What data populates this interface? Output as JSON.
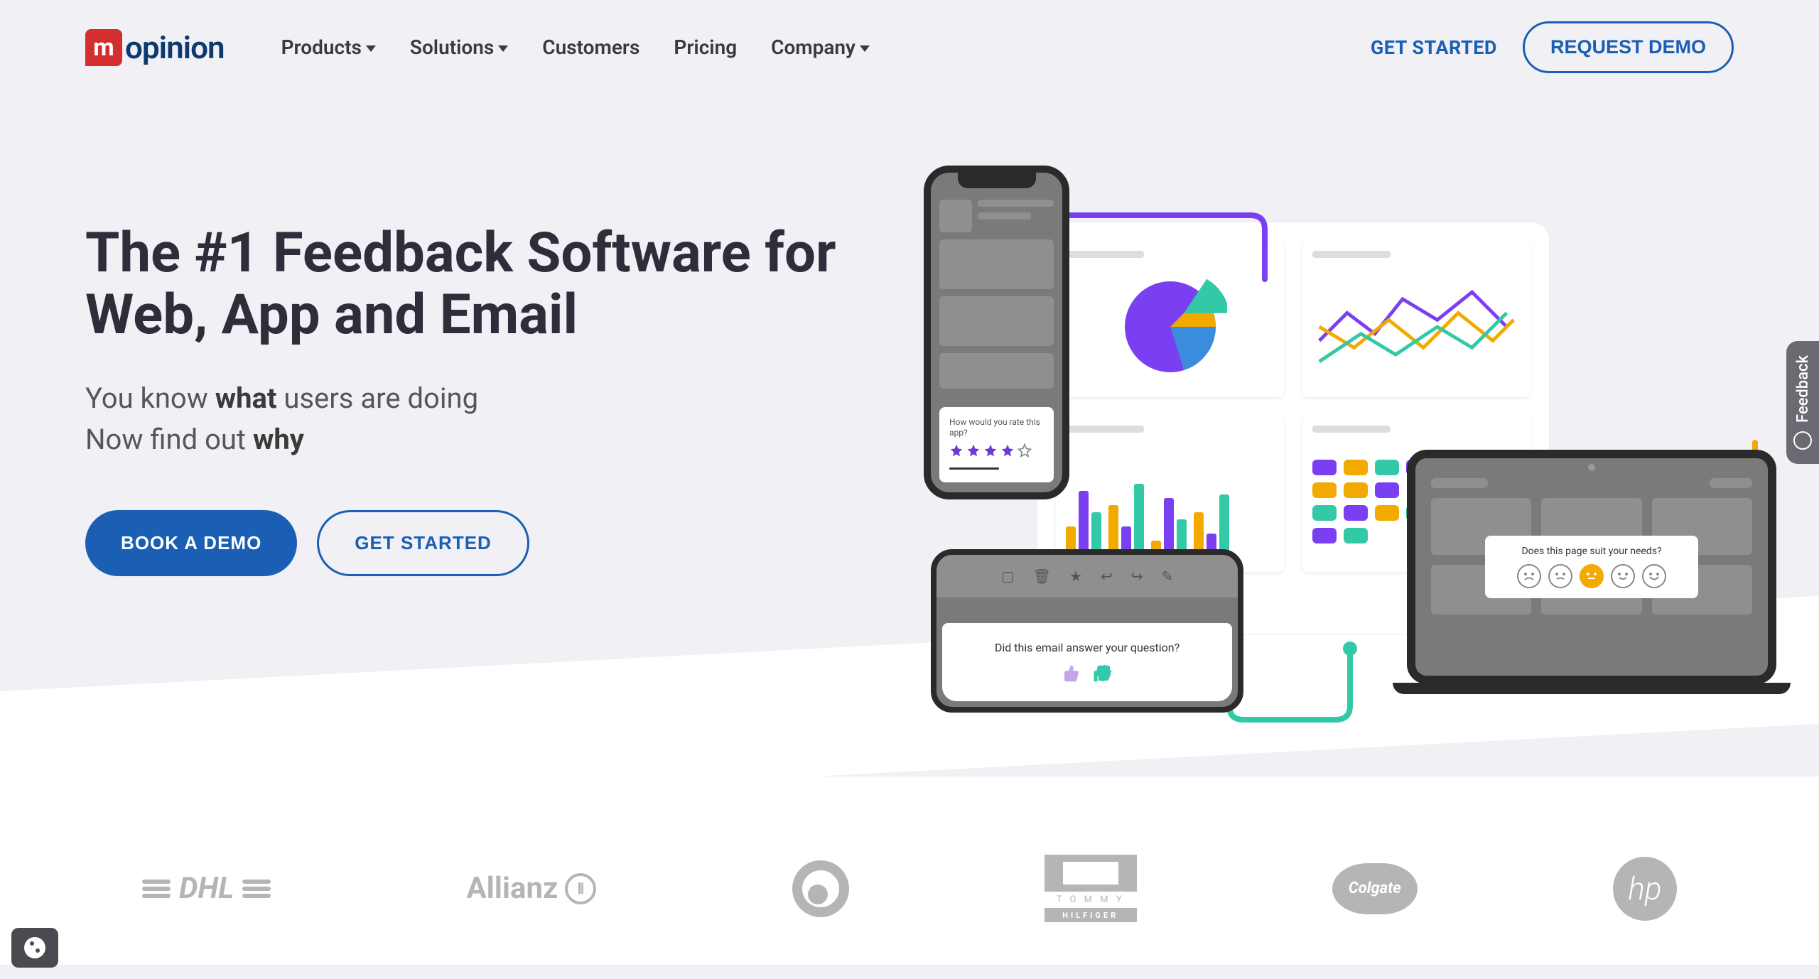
{
  "brand": {
    "mark": "m",
    "name": "opinion"
  },
  "nav": {
    "items": [
      {
        "label": "Products",
        "has_dropdown": true
      },
      {
        "label": "Solutions",
        "has_dropdown": true
      },
      {
        "label": "Customers",
        "has_dropdown": false
      },
      {
        "label": "Pricing",
        "has_dropdown": false
      },
      {
        "label": "Company",
        "has_dropdown": true
      }
    ]
  },
  "header_actions": {
    "get_started": "GET STARTED",
    "request_demo": "REQUEST DEMO"
  },
  "hero": {
    "title": "The #1 Feedback Software for Web, App and Email",
    "sub_line1_pre": "You know ",
    "sub_line1_strong": "what",
    "sub_line1_post": " users are doing",
    "sub_line2_pre": "Now find out ",
    "sub_line2_strong": "why",
    "cta_primary": "BOOK A DEMO",
    "cta_secondary": "GET STARTED"
  },
  "illustration": {
    "phone_question": "How would you rate this app?",
    "phone_rating_filled": 4,
    "phone_rating_total": 5,
    "email_question": "Did this email answer your question?",
    "laptop_question": "Does this page suit your needs?",
    "laptop_face_selected_index": 2,
    "colors": {
      "purple": "#7b3ff2",
      "teal": "#33c9a7",
      "yellow": "#f2a900",
      "blue": "#3a8ddc"
    }
  },
  "logos": [
    {
      "name": "DHL"
    },
    {
      "name": "Allianz"
    },
    {
      "name": "Vodafone"
    },
    {
      "name": "Tommy Hilfiger"
    },
    {
      "name": "Colgate"
    },
    {
      "name": "hp"
    }
  ],
  "feedback_tab": {
    "label": "Feedback"
  },
  "footer_labels": {
    "tommy_top": "T O M M Y",
    "tommy_bottom": "HILFIGER",
    "colgate": "Colgate",
    "hp": "hp",
    "allianz": "Allianz",
    "dhl": "DHL"
  }
}
